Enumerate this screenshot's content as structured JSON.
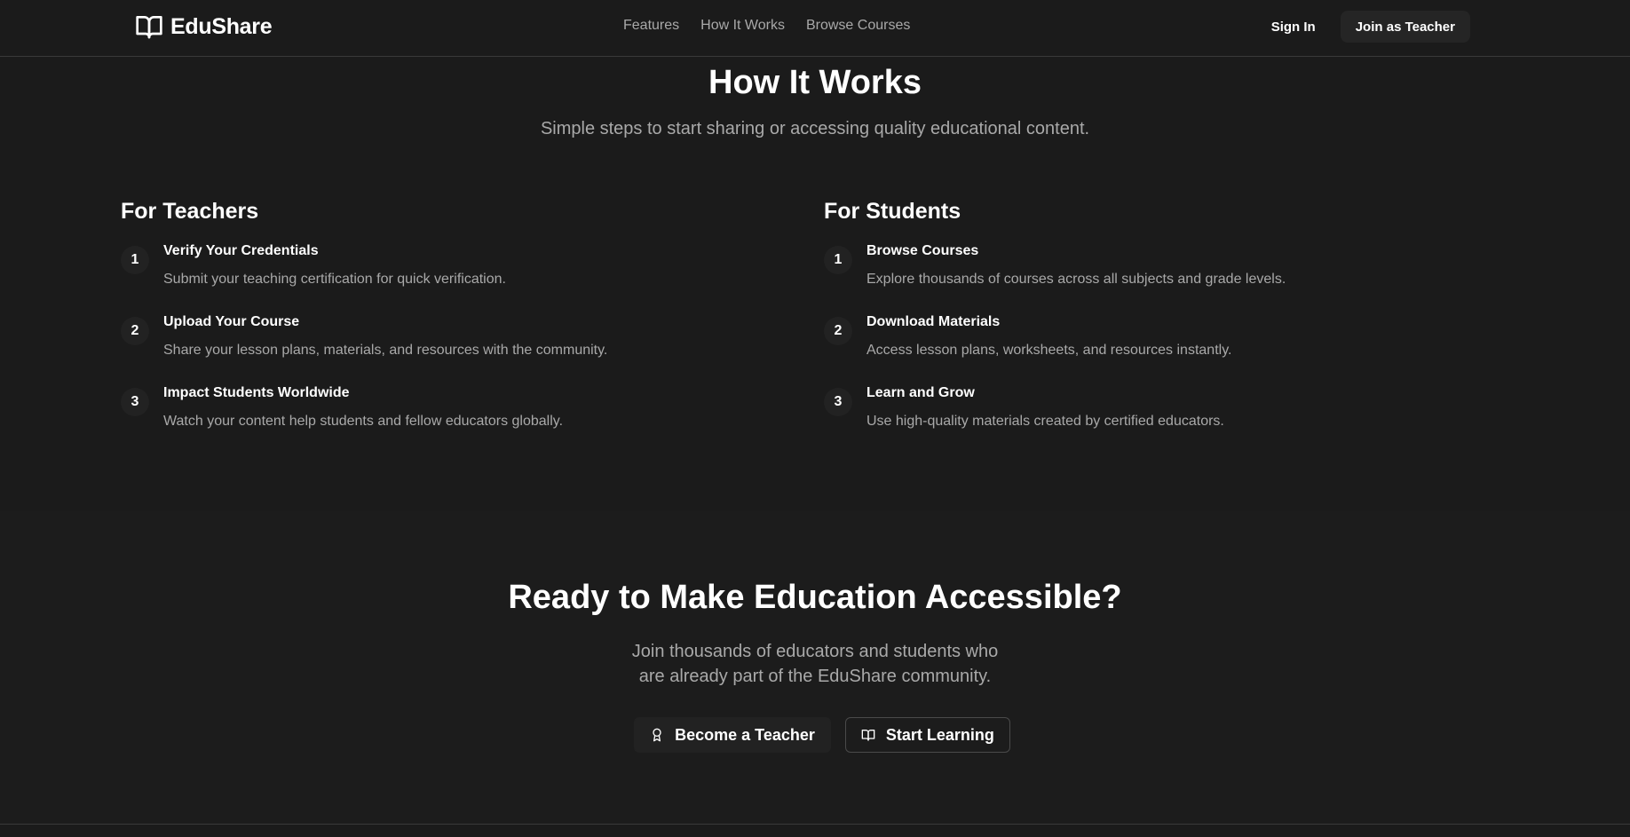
{
  "header": {
    "brand": "EduShare",
    "nav": [
      "Features",
      "How It Works",
      "Browse Courses"
    ],
    "sign_in": "Sign In",
    "join_teacher": "Join as Teacher"
  },
  "how_it_works": {
    "title": "How It Works",
    "subtitle": "Simple steps to start sharing or accessing quality educational content.",
    "teachers": {
      "title": "For Teachers",
      "steps": [
        {
          "num": "1",
          "title": "Verify Your Credentials",
          "desc": "Submit your teaching certification for quick verification."
        },
        {
          "num": "2",
          "title": "Upload Your Course",
          "desc": "Share your lesson plans, materials, and resources with the community."
        },
        {
          "num": "3",
          "title": "Impact Students Worldwide",
          "desc": "Watch your content help students and fellow educators globally."
        }
      ]
    },
    "students": {
      "title": "For Students",
      "steps": [
        {
          "num": "1",
          "title": "Browse Courses",
          "desc": "Explore thousands of courses across all subjects and grade levels."
        },
        {
          "num": "2",
          "title": "Download Materials",
          "desc": "Access lesson plans, worksheets, and resources instantly."
        },
        {
          "num": "3",
          "title": "Learn and Grow",
          "desc": "Use high-quality materials created by certified educators."
        }
      ]
    }
  },
  "cta": {
    "title": "Ready to Make Education Accessible?",
    "subtitle_lines": [
      "Join thousands of educators and students who",
      "are already part of the EduShare community."
    ],
    "become_teacher": "Become a Teacher",
    "start_learning": "Start Learning",
    "become_teacher_icon": "award-icon",
    "start_learning_icon": "book-open-icon"
  },
  "colors": {
    "background": "#1b1b1b",
    "muted_text": "#a9a9a9",
    "button_bg": "#252525",
    "border": "#3a3a3a"
  }
}
